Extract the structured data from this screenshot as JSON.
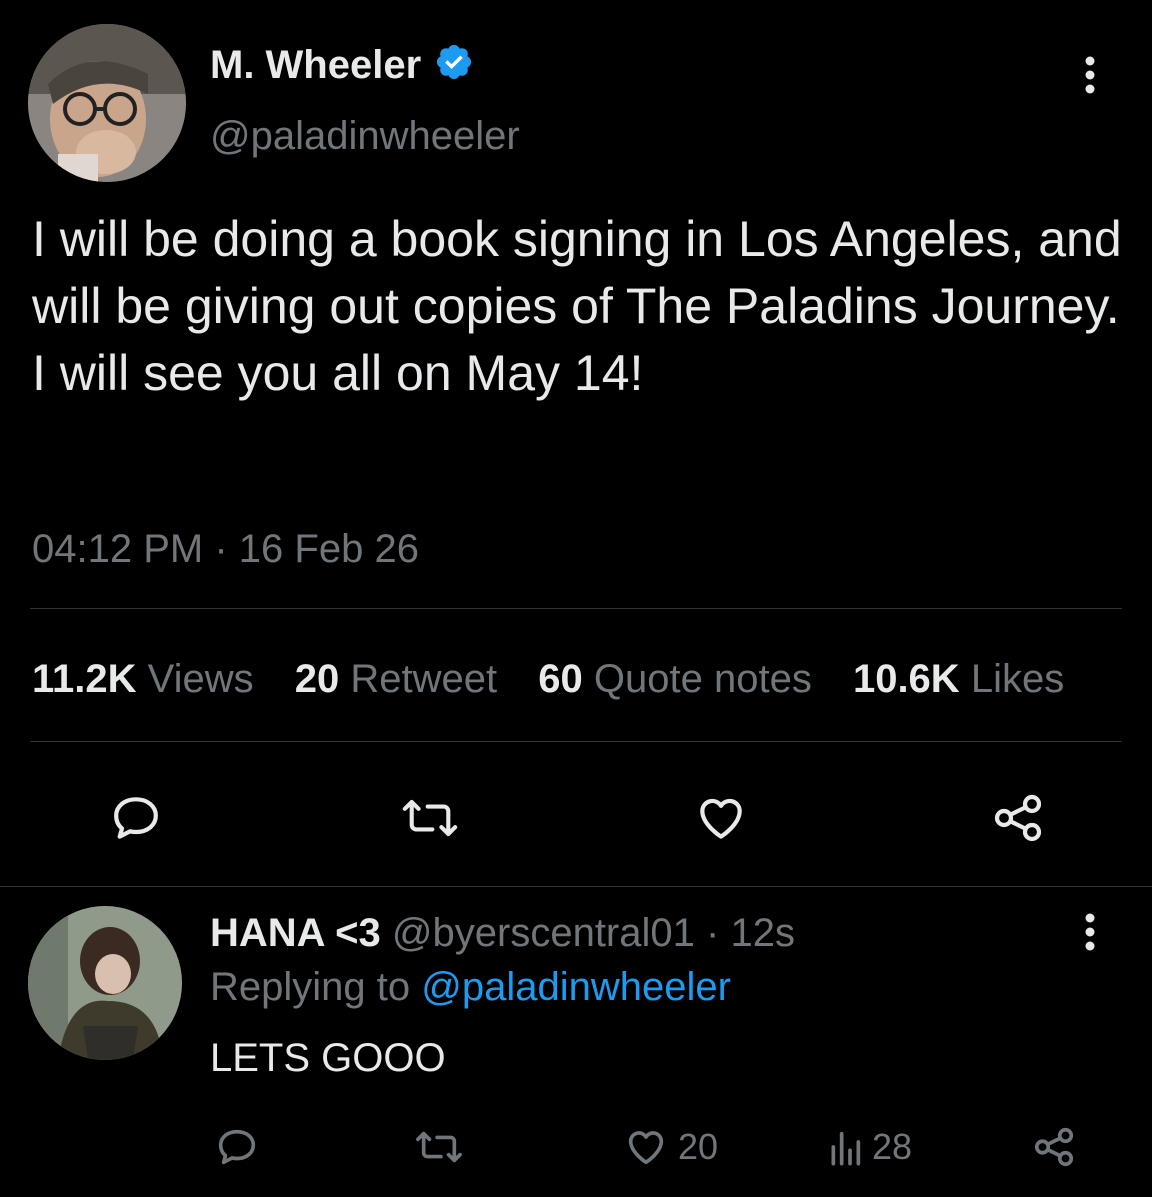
{
  "tweet": {
    "display_name": "M. Wheeler",
    "handle": "@paladinwheeler",
    "verified_icon": "verified-badge-icon",
    "text": "I will be doing a book signing in Los Angeles, and will be giving out copies of The Paladins Journey. I will see you all on May 14!",
    "time": "04:12 PM",
    "separator": "·",
    "date": "16 Feb 26",
    "stats": {
      "views_count": "11.2K",
      "views_label": "Views",
      "retweets_count": "20",
      "retweets_label": "Retweet",
      "quotes_count": "60",
      "quotes_label": "Quote notes",
      "likes_count": "10.6K",
      "likes_label": "Likes"
    },
    "actions": [
      "reply-icon",
      "retweet-icon",
      "like-icon",
      "share-icon"
    ]
  },
  "reply": {
    "display_name": "HANA <3",
    "handle": "@byerscentral01",
    "separator": "·",
    "age": "12s",
    "replying_label": "Replying to",
    "replying_to": "@paladinwheeler",
    "text": "LETS GOOO",
    "like_count": "20",
    "views_count": "28",
    "actions": [
      "reply-icon",
      "retweet-icon",
      "like-icon",
      "views-icon",
      "share-icon"
    ]
  },
  "colors": {
    "background": "#000000",
    "text": "#e7e9ea",
    "muted": "#71767b",
    "accent": "#1d9bf0",
    "divider": "#2f3336"
  }
}
